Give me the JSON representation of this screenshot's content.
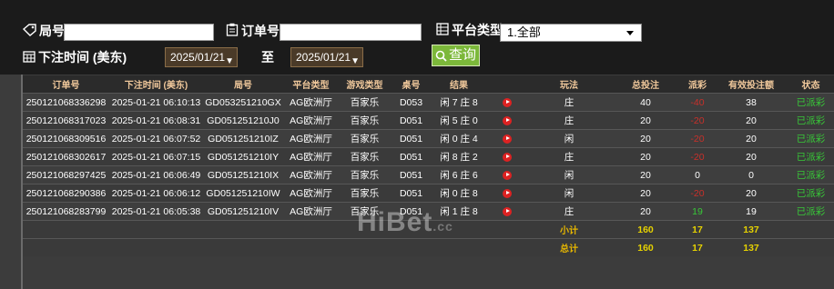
{
  "filters": {
    "game_no_label": "局号",
    "order_no_label": "订单号",
    "platform_label": "平台类型",
    "platform_selected": "1.全部",
    "bet_time_label": "下注时间 (美东)",
    "date_from": "2025/01/21",
    "to_label": "至",
    "date_to": "2025/01/21",
    "query_label": "查询"
  },
  "table": {
    "headers": [
      "订单号",
      "下注时间 (美东)",
      "局号",
      "平台类型",
      "游戏类型",
      "桌号",
      "结果",
      "",
      "玩法",
      "总投注",
      "派彩",
      "有效投注额",
      "状态"
    ],
    "rows": [
      {
        "order": "250121068336298",
        "time": "2025-01-21 06:10:13",
        "game": "GD053251210GX",
        "platform": "AG欧洲厅",
        "gtype": "百家乐",
        "table": "D053",
        "result": "闲 7 庄 8",
        "play": "庄",
        "bet": "40",
        "payout": "-40",
        "valid": "38",
        "status": "已派彩"
      },
      {
        "order": "250121068317023",
        "time": "2025-01-21 06:08:31",
        "game": "GD051251210J0",
        "platform": "AG欧洲厅",
        "gtype": "百家乐",
        "table": "D051",
        "result": "闲 5 庄 0",
        "play": "庄",
        "bet": "20",
        "payout": "-20",
        "valid": "20",
        "status": "已派彩"
      },
      {
        "order": "250121068309516",
        "time": "2025-01-21 06:07:52",
        "game": "GD051251210IZ",
        "platform": "AG欧洲厅",
        "gtype": "百家乐",
        "table": "D051",
        "result": "闲 0 庄 4",
        "play": "闲",
        "bet": "20",
        "payout": "-20",
        "valid": "20",
        "status": "已派彩"
      },
      {
        "order": "250121068302617",
        "time": "2025-01-21 06:07:15",
        "game": "GD051251210IY",
        "platform": "AG欧洲厅",
        "gtype": "百家乐",
        "table": "D051",
        "result": "闲 8 庄 2",
        "play": "庄",
        "bet": "20",
        "payout": "-20",
        "valid": "20",
        "status": "已派彩"
      },
      {
        "order": "250121068297425",
        "time": "2025-01-21 06:06:49",
        "game": "GD051251210IX",
        "platform": "AG欧洲厅",
        "gtype": "百家乐",
        "table": "D051",
        "result": "闲 6 庄 6",
        "play": "闲",
        "bet": "20",
        "payout": "0",
        "valid": "0",
        "status": "已派彩"
      },
      {
        "order": "250121068290386",
        "time": "2025-01-21 06:06:12",
        "game": "GD051251210IW",
        "platform": "AG欧洲厅",
        "gtype": "百家乐",
        "table": "D051",
        "result": "闲 0 庄 8",
        "play": "闲",
        "bet": "20",
        "payout": "-20",
        "valid": "20",
        "status": "已派彩"
      },
      {
        "order": "250121068283799",
        "time": "2025-01-21 06:05:38",
        "game": "GD051251210IV",
        "platform": "AG欧洲厅",
        "gtype": "百家乐",
        "table": "D051",
        "result": "闲 1 庄 8",
        "play": "庄",
        "bet": "20",
        "payout": "19",
        "valid": "19",
        "status": "已派彩"
      }
    ],
    "subtotal": {
      "label": "小计",
      "bet": "160",
      "payout": "17",
      "valid": "137"
    },
    "total": {
      "label": "总计",
      "bet": "160",
      "payout": "17",
      "valid": "137"
    }
  },
  "watermark": {
    "text": "HiBet",
    "suffix": ".cc"
  },
  "colors": {
    "accent_green": "#7cb83a",
    "header_text": "#f0c89b",
    "sum_yellow": "#e6d200",
    "negative": "#c8302a",
    "positive": "#38c838",
    "status": "#38c838"
  }
}
